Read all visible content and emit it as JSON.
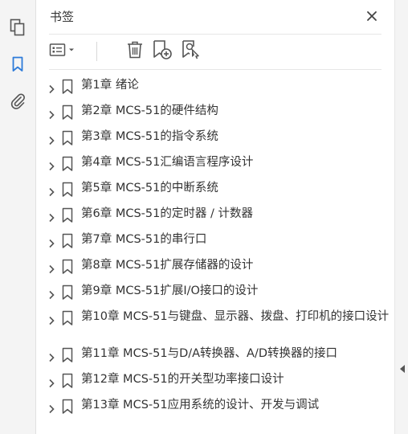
{
  "panel": {
    "title": "书签",
    "close_icon": "close-icon"
  },
  "sidebar": {
    "icons": [
      "pages-icon",
      "bookmark-icon",
      "attachment-icon"
    ],
    "active": "bookmark-icon",
    "accent": "#2d7bd9"
  },
  "toolbar": {
    "buttons": [
      "options-menu-icon",
      "delete-icon",
      "add-bookmark-icon",
      "search-bookmark-icon"
    ]
  },
  "bookmarks": [
    {
      "label": "第1章  绪论"
    },
    {
      "label": "第2章  MCS-51的硬件结构"
    },
    {
      "label": "第3章  MCS-51的指令系统"
    },
    {
      "label": "第4章  MCS-51汇编语言程序设计"
    },
    {
      "label": "第5章  MCS-51的中断系统"
    },
    {
      "label": "第6章  MCS-51的定时器 / 计数器"
    },
    {
      "label": "第7章  MCS-51的串行口"
    },
    {
      "label": "第8章  MCS-51扩展存储器的设计"
    },
    {
      "label": "第9章  MCS-51扩展I/O接口的设计"
    },
    {
      "label": "第10章  MCS-51与键盘、显示器、拨盘、打印机的接口设计"
    },
    {
      "label": "第11章  MCS-51与D/A转换器、A/D转换器的接口"
    },
    {
      "label": "第12章  MCS-51的开关型功率接口设计"
    },
    {
      "label": "第13章  MCS-51应用系统的设计、开发与调试"
    }
  ]
}
